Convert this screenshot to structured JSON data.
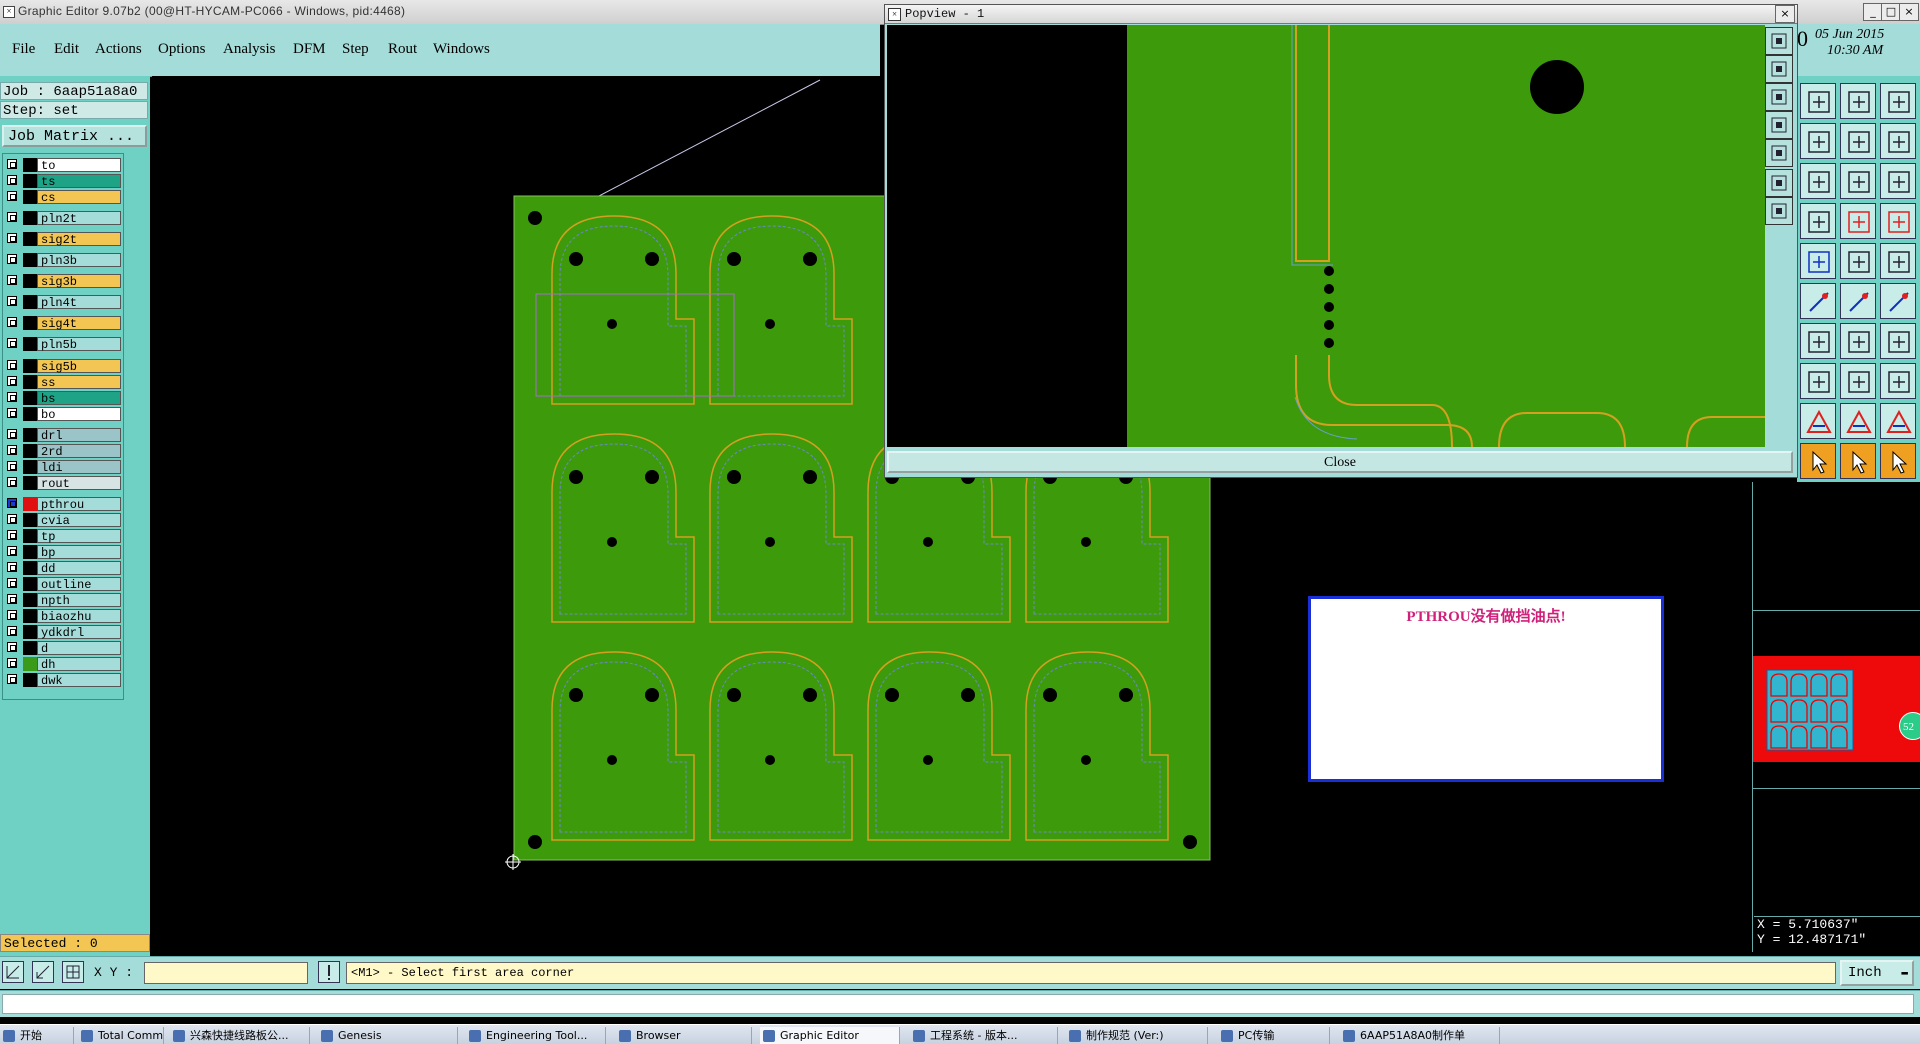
{
  "window": {
    "title": "Graphic Editor 9.07b2 (00@HT-HYCAM-PC066 - Windows, pid:4468)"
  },
  "menu": [
    "File",
    "Edit",
    "Actions",
    "Options",
    "Analysis",
    "DFM",
    "Step",
    "Rout",
    "Windows"
  ],
  "job": {
    "job_line": "Job : 6aap51a8a0",
    "step_line": "Step: set",
    "matrix_button": "Job Matrix ..."
  },
  "layers": [
    {
      "name": "to",
      "color": "#ffffff",
      "swatch": "#000000"
    },
    {
      "name": "ts",
      "color": "#1ea387",
      "swatch": "#000000"
    },
    {
      "name": "cs",
      "color": "#f3c654",
      "swatch": "#000000"
    },
    {
      "name": "pln2t",
      "color": "#a3dcd8",
      "swatch": "#000000"
    },
    {
      "name": "sig2t",
      "color": "#f3c654",
      "swatch": "#000000"
    },
    {
      "name": "pln3b",
      "color": "#a3dcd8",
      "swatch": "#000000"
    },
    {
      "name": "sig3b",
      "color": "#f3c654",
      "swatch": "#000000"
    },
    {
      "name": "pln4t",
      "color": "#a3dcd8",
      "swatch": "#000000"
    },
    {
      "name": "sig4t",
      "color": "#f3c654",
      "swatch": "#000000"
    },
    {
      "name": "pln5b",
      "color": "#a3dcd8",
      "swatch": "#000000"
    },
    {
      "name": "sig5b",
      "color": "#f3c654",
      "swatch": "#000000"
    },
    {
      "name": "ss",
      "color": "#f3c654",
      "swatch": "#000000"
    },
    {
      "name": "bs",
      "color": "#1ea387",
      "swatch": "#000000"
    },
    {
      "name": "bo",
      "color": "#ffffff",
      "swatch": "#000000"
    },
    {
      "name": "drl",
      "color": "#9ac4c8",
      "swatch": "#000000"
    },
    {
      "name": "2rd",
      "color": "#9ac4c8",
      "swatch": "#000000"
    },
    {
      "name": "ldi",
      "color": "#9ac4c8",
      "swatch": "#000000"
    },
    {
      "name": "rout",
      "color": "#d8e4e4",
      "swatch": "#000000"
    },
    {
      "name": "pthrou",
      "color": "#a3dcd8",
      "swatch": "#e01010",
      "active": true
    },
    {
      "name": "cvia",
      "color": "#a3dcd8",
      "swatch": "#000000"
    },
    {
      "name": "tp",
      "color": "#a3dcd8",
      "swatch": "#000000"
    },
    {
      "name": "bp",
      "color": "#a3dcd8",
      "swatch": "#000000"
    },
    {
      "name": "dd",
      "color": "#a3dcd8",
      "swatch": "#000000"
    },
    {
      "name": "outline",
      "color": "#a3dcd8",
      "swatch": "#000000"
    },
    {
      "name": "npth",
      "color": "#a3dcd8",
      "swatch": "#000000"
    },
    {
      "name": "biaozhu",
      "color": "#a3dcd8",
      "swatch": "#000000"
    },
    {
      "name": "ydkdrl",
      "color": "#a3dcd8",
      "swatch": "#000000"
    },
    {
      "name": "d",
      "color": "#a3dcd8",
      "swatch": "#000000"
    },
    {
      "name": "dh",
      "color": "#a3dcd8",
      "swatch": "#3a9a1a"
    },
    {
      "name": "dwk",
      "color": "#a3dcd8",
      "swatch": "#000000"
    }
  ],
  "selected": "Selected : 0",
  "popview": {
    "title": "Popview - 1",
    "close_label": "Close"
  },
  "datetime": {
    "date": "05 Jun 2015",
    "time": "10:30 AM"
  },
  "message": "PTHROU没有做挡油点!",
  "coords": {
    "x": "X = 5.710637\"",
    "y": "Y = 12.487171\""
  },
  "command": {
    "xy_label": "X Y :",
    "prompt": "<M1> - Select first area corner",
    "units": "Inch"
  },
  "taskbar": [
    "开始",
    "Total Commander",
    "兴森快捷线路板公...",
    "Genesis",
    "Engineering Tool...",
    "Browser",
    "Graphic Editor",
    "工程系统 - 版本...",
    "制作规范 (Ver:)",
    "PC传输",
    "6AAP51A8A0制作单"
  ],
  "colors": {
    "panel": "#a3dcd8",
    "board": "#3d9a0b",
    "trace": "#d4a020"
  },
  "minimap_badge": "52"
}
